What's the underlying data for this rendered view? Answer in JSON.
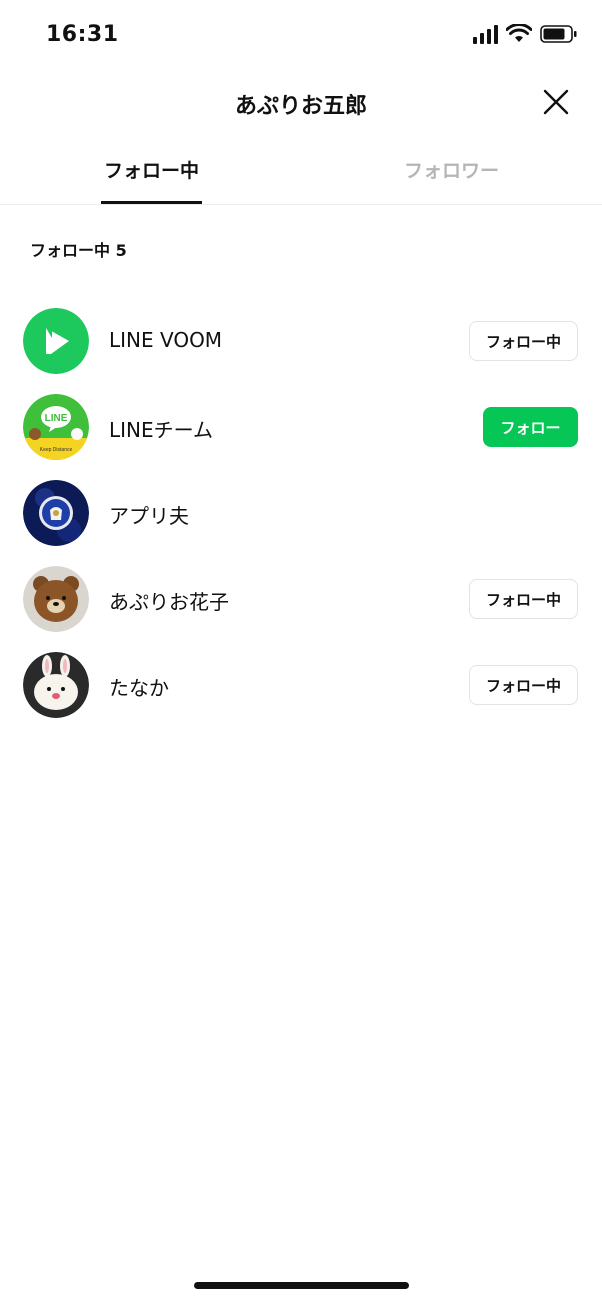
{
  "status_bar": {
    "time": "16:31"
  },
  "header": {
    "title": "あぷりお五郎"
  },
  "tabs": [
    {
      "label": "フォロー中",
      "active": true
    },
    {
      "label": "フォロワー",
      "active": false
    }
  ],
  "section": {
    "title": "フォロー中 5"
  },
  "colors": {
    "accent": "#06c755",
    "inactive_tab": "#b5b5b5"
  },
  "rows": [
    {
      "name": "LINE VOOM",
      "avatar": "line-voom-logo",
      "button": "フォロー中"
    },
    {
      "name": "LINEチーム",
      "avatar": "line-logo",
      "avatar_text": "LINE",
      "avatar_badge": "Keep Distance",
      "button": "フォロー"
    },
    {
      "name": "アプリ夫",
      "avatar": "chelsea-crest"
    },
    {
      "name": "あぷりお花子",
      "avatar": "brown-bear-plush",
      "button": "フォロー中"
    },
    {
      "name": "たなか",
      "avatar": "white-rabbit-plush",
      "button": "フォロー中"
    }
  ]
}
